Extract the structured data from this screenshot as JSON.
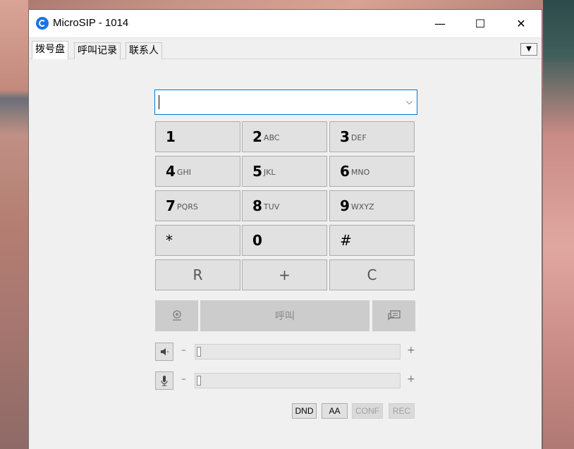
{
  "window": {
    "title": "MicroSIP - 1014",
    "minimize": "—",
    "maximize": "☐",
    "close": "✕"
  },
  "tabs": [
    {
      "label": "拨号盘",
      "active": true
    },
    {
      "label": "呼叫记录",
      "active": false
    },
    {
      "label": "联系人",
      "active": false
    }
  ],
  "tabs_dropdown": "▼",
  "dial_input": {
    "value": "",
    "placeholder": ""
  },
  "dropdown_arrow": "⌵",
  "keys": [
    {
      "digit": "1",
      "letters": ""
    },
    {
      "digit": "2",
      "letters": "ABC"
    },
    {
      "digit": "3",
      "letters": "DEF"
    },
    {
      "digit": "4",
      "letters": "GHI"
    },
    {
      "digit": "5",
      "letters": "JKL"
    },
    {
      "digit": "6",
      "letters": "MNO"
    },
    {
      "digit": "7",
      "letters": "PQRS"
    },
    {
      "digit": "8",
      "letters": "TUV"
    },
    {
      "digit": "9",
      "letters": "WXYZ"
    },
    {
      "digit": "*",
      "letters": ""
    },
    {
      "digit": "0",
      "letters": ""
    },
    {
      "digit": "#",
      "letters": ""
    }
  ],
  "function_keys": {
    "redial": "R",
    "plus": "+",
    "clear": "C"
  },
  "call": {
    "video_icon": "webcam-icon",
    "call_label": "呼叫",
    "message_icon": "chat-icon"
  },
  "speaker": {
    "minus": "–",
    "plus": "+",
    "level": 0.0
  },
  "microphone": {
    "minus": "–",
    "plus": "+",
    "level": 0.0
  },
  "status_buttons": [
    {
      "label": "DND",
      "enabled": true
    },
    {
      "label": "AA",
      "enabled": true
    },
    {
      "label": "CONF",
      "enabled": false
    },
    {
      "label": "REC",
      "enabled": false
    }
  ]
}
